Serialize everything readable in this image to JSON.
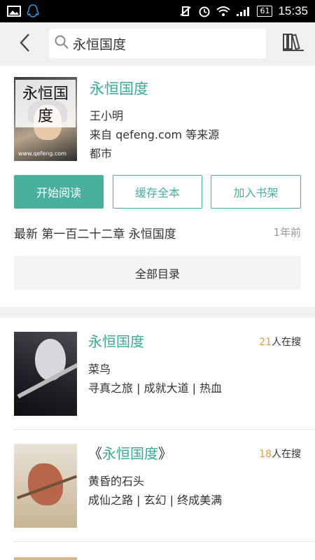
{
  "status_bar": {
    "battery": "61",
    "time": "15:35"
  },
  "search": {
    "query": "永恒国度"
  },
  "book": {
    "title": "永恒国度",
    "cover_text": "永恒国度",
    "cover_url": "www.qefeng.com",
    "author": "王小明",
    "source": "来自 qefeng.com 等来源",
    "category": "都市",
    "buttons": {
      "read": "开始阅读",
      "cache": "缓存全本",
      "add_shelf": "加入书架"
    },
    "latest_chapter": "最新 第一百二十二章 永恒国度",
    "latest_time": "1年前",
    "toc_label": "全部目录"
  },
  "results": [
    {
      "title": "永恒国度",
      "prefix": "",
      "suffix": "",
      "count": "21",
      "count_suffix": "人在搜",
      "author": "菜鸟",
      "tags": "寻真之旅 | 成就大道 | 热血"
    },
    {
      "title": "永恒国度",
      "prefix": "《",
      "suffix": "》",
      "count": "18",
      "count_suffix": "人在搜",
      "author": "黄昏的石头",
      "tags": "成仙之路 | 玄幻 | 终成美满"
    }
  ],
  "colors": {
    "accent": "#48b09d",
    "count_highlight": "#e59a3a"
  }
}
